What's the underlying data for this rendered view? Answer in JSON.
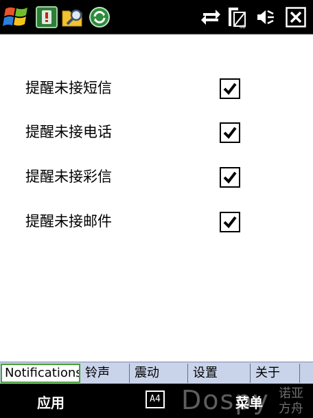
{
  "settings": {
    "items": [
      {
        "label": "提醒未接短信",
        "checked": true
      },
      {
        "label": "提醒未接电话",
        "checked": true
      },
      {
        "label": "提醒未接彩信",
        "checked": true
      },
      {
        "label": "提醒未接邮件",
        "checked": true
      }
    ]
  },
  "tabs": [
    {
      "label": "Notifications",
      "active": true
    },
    {
      "label": "铃声",
      "active": false
    },
    {
      "label": "震动",
      "active": false
    },
    {
      "label": "设置",
      "active": false
    },
    {
      "label": "关于",
      "active": false
    }
  ],
  "softkeys": {
    "left": "应用",
    "right": "菜单",
    "sip": "A4"
  },
  "watermark": {
    "main": "Dospy",
    "cn_line1": "诺亚",
    "cn_line2": "方舟"
  },
  "colors": {
    "statusbar": "#000000",
    "tab_active_border": "#46a036",
    "tab_bg": "#c9d4ea"
  },
  "icons": {
    "statusbar": [
      "windows-start-icon",
      "missed-call-app-icon",
      "search-folder-icon",
      "sync-app-icon",
      "connectivity-icon",
      "signal-icon",
      "volume-icon",
      "close-icon"
    ]
  }
}
